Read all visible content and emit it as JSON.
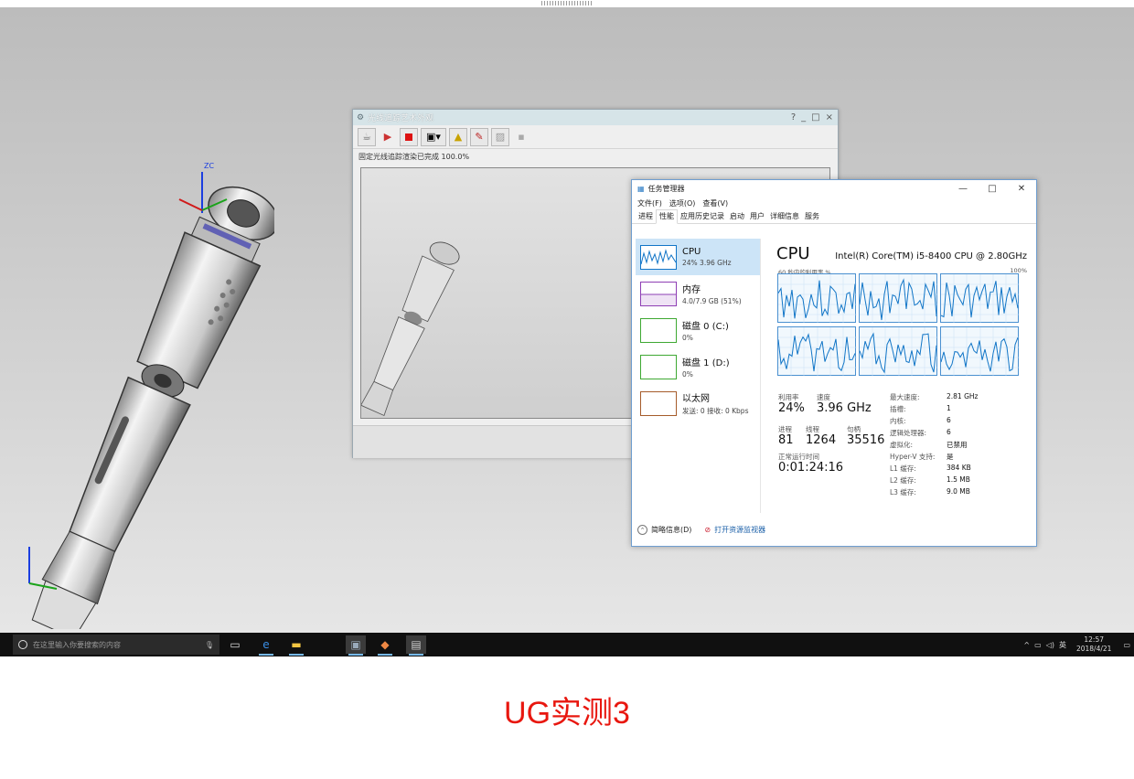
{
  "render_window": {
    "title": "光线追踪艺术外观",
    "controls": [
      "?",
      "_",
      "□",
      "×"
    ],
    "toolbar_icons": [
      "teapot-icon",
      "play-icon",
      "stop-icon",
      "camera-icon",
      "image-icon",
      "color-palette-icon",
      "clear-icon",
      "save-icon"
    ],
    "status": "固定光线追踪渲染已完成 100.0%"
  },
  "task_manager": {
    "title": "任务管理器",
    "window_controls": [
      "—",
      "□",
      "✕"
    ],
    "menu": [
      "文件(F)",
      "选项(O)",
      "查看(V)"
    ],
    "tabs": [
      "进程",
      "性能",
      "应用历史记录",
      "启动",
      "用户",
      "详细信息",
      "服务"
    ],
    "active_tab": "性能",
    "sidebar": [
      {
        "name": "CPU",
        "value": "24% 3.96 GHz",
        "color": "#1175c7"
      },
      {
        "name": "内存",
        "value": "4.0/7.9 GB (51%)",
        "color": "#8e3fb4"
      },
      {
        "name": "磁盘 0 (C:)",
        "value": "0%",
        "color": "#3ea832"
      },
      {
        "name": "磁盘 1 (D:)",
        "value": "0%",
        "color": "#3ea832"
      },
      {
        "name": "以太网",
        "value": "发送: 0 接收: 0 Kbps",
        "color": "#a55b2a"
      }
    ],
    "cpu": {
      "heading": "CPU",
      "model": "Intel(R) Core(TM) i5-8400 CPU @ 2.80GHz",
      "graph_label_left": "60 秒内的利用率 %",
      "graph_label_right": "100%",
      "utilization_label": "利用率",
      "utilization": "24%",
      "speed_label": "速度",
      "speed": "3.96 GHz",
      "processes_label": "进程",
      "processes": "81",
      "threads_label": "线程",
      "threads": "1264",
      "handles_label": "句柄",
      "handles": "35516",
      "uptime_label": "正常运行时间",
      "uptime": "0:01:24:16",
      "details": [
        {
          "k": "最大速度:",
          "v": "2.81 GHz"
        },
        {
          "k": "插槽:",
          "v": "1"
        },
        {
          "k": "内核:",
          "v": "6"
        },
        {
          "k": "逻辑处理器:",
          "v": "6"
        },
        {
          "k": "虚拟化:",
          "v": "已禁用"
        },
        {
          "k": "Hyper-V 支持:",
          "v": "是"
        },
        {
          "k": "L1 缓存:",
          "v": "384 KB"
        },
        {
          "k": "L2 缓存:",
          "v": "1.5 MB"
        },
        {
          "k": "L3 缓存:",
          "v": "9.0 MB"
        }
      ]
    },
    "footer_brief": "简略信息(D)",
    "footer_monitor": "打开资源监视器"
  },
  "taskbar": {
    "search_placeholder": "在这里输入你要搜索的内容",
    "tray_lang": "英",
    "time": "12:57",
    "date": "2018/4/21"
  },
  "viewport_axis_label": "ZC",
  "caption": "UG实测3"
}
